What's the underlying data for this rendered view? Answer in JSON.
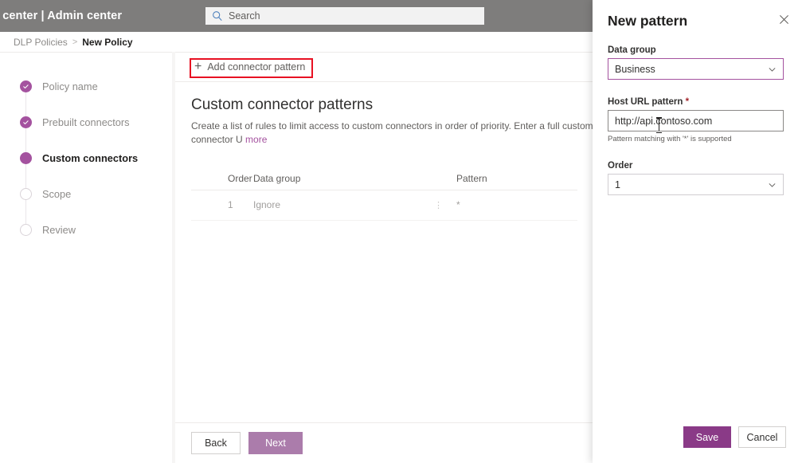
{
  "suite": {
    "title": "min center | Admin center",
    "search_placeholder": "Search",
    "search_icon": "search-icon"
  },
  "breadcrumb": {
    "parent": "DLP Policies",
    "separator": ">",
    "current": "New Policy"
  },
  "wizard": {
    "steps": [
      {
        "label": "Policy name",
        "state": "done"
      },
      {
        "label": "Prebuilt connectors",
        "state": "done"
      },
      {
        "label": "Custom connectors",
        "state": "current"
      },
      {
        "label": "Scope",
        "state": "todo"
      },
      {
        "label": "Review",
        "state": "todo"
      }
    ]
  },
  "command_bar": {
    "add_pattern_label": "Add connector pattern",
    "add_icon": "plus-icon"
  },
  "main": {
    "heading": "Custom connector patterns",
    "description": "Create a list of rules to limit access to custom connectors in order of priority. Enter a full custom connector U",
    "more_link": "more",
    "table": {
      "columns": [
        "Order",
        "Data group",
        "Pattern"
      ],
      "rows": [
        {
          "order": "1",
          "data_group": "Ignore",
          "menu": "⋮",
          "pattern": "*"
        }
      ]
    },
    "footer": {
      "back_label": "Back",
      "next_label": "Next"
    }
  },
  "panel": {
    "title": "New pattern",
    "close_icon": "close-icon",
    "data_group": {
      "label": "Data group",
      "value": "Business",
      "chevron_icon": "chevron-down-icon"
    },
    "host_url": {
      "label": "Host URL pattern",
      "required_marker": "*",
      "value": "http://api.contoso.com",
      "hint": "Pattern matching with '*' is supported"
    },
    "order": {
      "label": "Order",
      "value": "1",
      "chevron_icon": "chevron-down-icon"
    },
    "save_label": "Save",
    "cancel_label": "Cancel"
  },
  "colors": {
    "accent_purple": "#a4529f",
    "save_purple": "#8a3a87",
    "next_purple": "#ab7cab",
    "highlight_red": "#e81123",
    "suitebar_gray": "#7e7d7c"
  }
}
